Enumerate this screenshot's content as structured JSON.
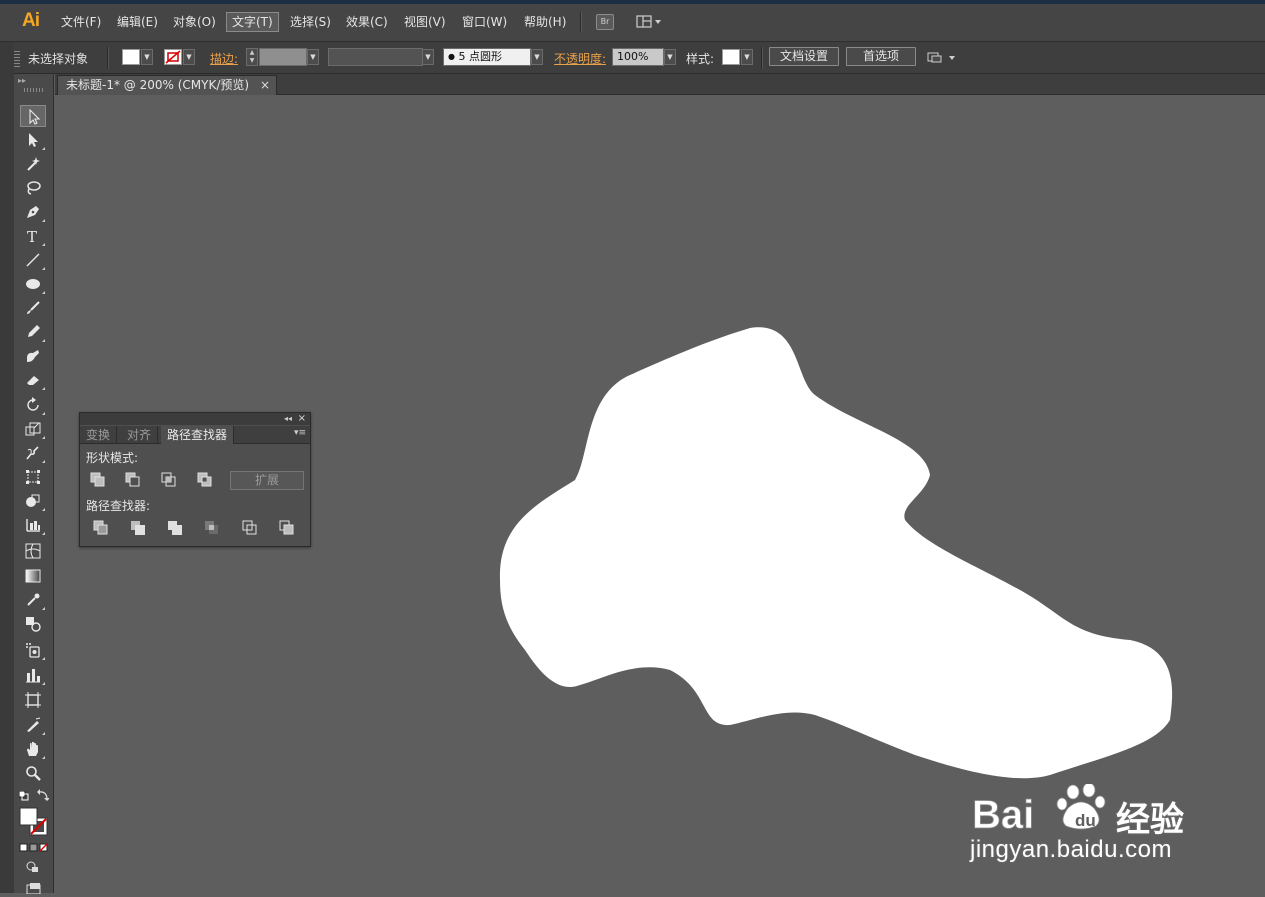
{
  "app": {
    "logo": "Ai"
  },
  "menu": {
    "items": [
      "文件(F)",
      "编辑(E)",
      "对象(O)",
      "文字(T)",
      "选择(S)",
      "效果(C)",
      "视图(V)",
      "窗口(W)",
      "帮助(H)"
    ],
    "active_index": 3,
    "bridge_label": "Br"
  },
  "control_bar": {
    "status": "未选择对象",
    "stroke_label": "描边:",
    "brush_label": "5 点圆形",
    "opacity_label": "不透明度:",
    "opacity_value": "100%",
    "style_label": "样式:",
    "doc_setup_button": "文档设置",
    "preferences_button": "首选项"
  },
  "document": {
    "tab_title": "未标题-1* @ 200% (CMYK/预览)",
    "close_glyph": "×"
  },
  "pathfinder_panel": {
    "tabs": [
      "变换",
      "对齐",
      "路径查找器"
    ],
    "active_tab": 2,
    "shape_modes_label": "形状模式:",
    "expand_button": "扩展",
    "pathfinders_label": "路径查找器:",
    "close_glyph": "×",
    "collapse_glyph": "◂◂"
  },
  "canvas": {
    "shape_fill": "#ffffff",
    "background": "#5e5e5e"
  },
  "watermark": {
    "text": "Bai经验",
    "url": "jingyan.baidu.com"
  },
  "colors": {
    "accent_orange": "#f5a623",
    "link_orange": "#e8a04b"
  },
  "tools": [
    "selection-tool-icon",
    "direct-selection-tool-icon",
    "magic-wand-tool-icon",
    "lasso-tool-icon",
    "pen-tool-icon",
    "type-tool-icon",
    "line-tool-icon",
    "ellipse-tool-icon",
    "paintbrush-tool-icon",
    "pencil-tool-icon",
    "blob-brush-tool-icon",
    "eraser-tool-icon",
    "rotate-tool-icon",
    "scale-tool-icon",
    "warp-tool-icon",
    "free-transform-tool-icon",
    "shape-builder-tool-icon",
    "perspective-grid-tool-icon",
    "mesh-tool-icon",
    "gradient-tool-icon",
    "eyedropper-tool-icon",
    "blend-tool-icon",
    "symbol-sprayer-tool-icon",
    "column-graph-tool-icon",
    "artboard-tool-icon",
    "slice-tool-icon",
    "hand-tool-icon",
    "zoom-tool-icon"
  ]
}
